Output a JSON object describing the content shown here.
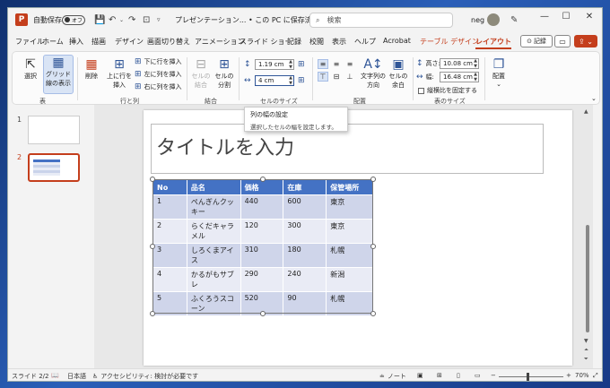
{
  "window": {
    "logo": "P",
    "autosave_label": "自動保存",
    "autosave_state": "オフ",
    "doc_title": "プレゼンテーション... • この PC に保存済み",
    "search_placeholder": "検索",
    "user_name": "neg"
  },
  "menu": {
    "tabs": [
      "ファイル",
      "ホーム",
      "挿入",
      "描画",
      "デザイン",
      "画面切り替え",
      "アニメーション",
      "スライド ショー",
      "記録",
      "校閲",
      "表示",
      "ヘルプ",
      "Acrobat",
      "テーブル デザイン",
      "レイアウト"
    ],
    "record_label": "記録"
  },
  "ribbon": {
    "select_label": "選択",
    "gridlines_label": "グリッド線の表示",
    "table_group": "表",
    "delete_label": "削除",
    "insert_above_label": "上に行を挿入",
    "insert_below_label": "下に行を挿入",
    "insert_left_label": "左に列を挿入",
    "insert_right_label": "右に列を挿入",
    "rows_cols_group": "行と列",
    "merge_cells_label": "セルの結合",
    "split_cells_label": "セルの分割",
    "merge_group": "結合",
    "cell_height_value": "1.19 cm",
    "cell_width_value": "4 cm",
    "cell_size_group": "セルのサイズ",
    "text_direction_label": "文字列の方向",
    "cell_margins_label": "セルの余白",
    "alignment_group": "配置",
    "table_height_label": "高さ:",
    "table_height_value": "10.08 cm",
    "table_width_label": "幅:",
    "table_width_value": "16.48 cm",
    "lock_ratio_label": "縦横比を固定する",
    "table_size_group": "表のサイズ",
    "arrange_label": "配置"
  },
  "tooltip": {
    "title": "列の幅の設定",
    "description": "選択したセルの幅を設定します。"
  },
  "slides": {
    "numbers": [
      "1",
      "2"
    ]
  },
  "slide": {
    "title_placeholder": "タイトルを入力",
    "table": {
      "headers": [
        "No",
        "品名",
        "価格",
        "在庫",
        "保管場所"
      ],
      "rows": [
        [
          "1",
          "ぺんぎんクッキー",
          "440",
          "600",
          "東京"
        ],
        [
          "2",
          "らくだキャラメル",
          "120",
          "300",
          "東京"
        ],
        [
          "3",
          "しろくまアイス",
          "310",
          "180",
          "札幌"
        ],
        [
          "4",
          "かるがもサブレ",
          "290",
          "240",
          "新潟"
        ],
        [
          "5",
          "ふくろうスコーン",
          "520",
          "90",
          "札幌"
        ]
      ]
    }
  },
  "status": {
    "slide_indicator": "スライド 2/2",
    "language": "日本語",
    "accessibility": "アクセシビリティ: 検討が必要です",
    "notes": "ノート",
    "zoom": "70%"
  }
}
